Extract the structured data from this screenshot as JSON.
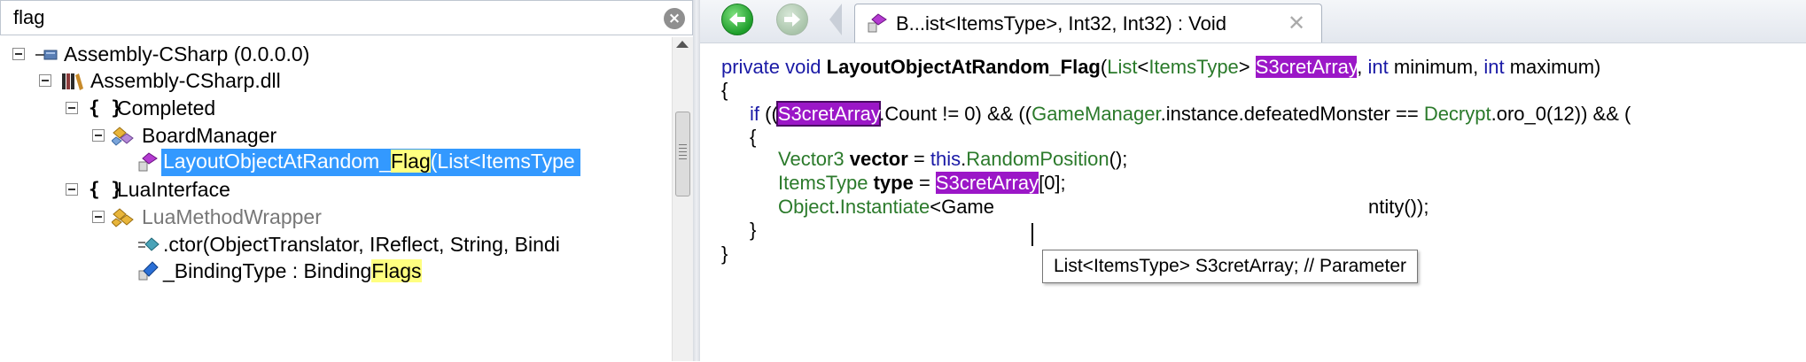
{
  "search": {
    "value": "flag",
    "clear_label": "⨯"
  },
  "tree": [
    {
      "label": "Assembly-CSharp (0.0.0.0)",
      "icon": "assembly-icon"
    },
    {
      "label": "Assembly-CSharp.dll",
      "icon": "library-icon"
    },
    {
      "label": "Completed",
      "icon": "namespace-braces-icon",
      "glyph": "{ }"
    },
    {
      "label": "BoardManager",
      "icon": "class-icon"
    },
    {
      "label_pre": "LayoutObjectAtRandom_",
      "label_hl": "Flag",
      "label_post": "(List<ItemsType",
      "icon": "method-icon",
      "selected": true
    },
    {
      "label": "LuaInterface",
      "icon": "namespace-braces-icon",
      "glyph": "{ }"
    },
    {
      "label": "LuaMethodWrapper",
      "icon": "class-icon"
    },
    {
      "label": ".ctor(ObjectTranslator, IReflect, String, Bindi",
      "icon": "constructor-icon"
    },
    {
      "label_pre": "_BindingType : Binding",
      "label_hl": "Flags",
      "label_post": "",
      "icon": "field-icon"
    }
  ],
  "tab": {
    "title": "B...ist<ItemsType>, Int32, Int32) : Void",
    "close": "✕"
  },
  "code": {
    "l1": {
      "kw1": "private void ",
      "method": "LayoutObjectAtRandom_Flag",
      "p1": "(",
      "t1": "List",
      "p2": "<",
      "t2": "ItemsType",
      "p3": "> ",
      "param": "S3cretArray",
      "p4": ", ",
      "kw2": "int",
      "p5": " minimum, ",
      "kw3": "int",
      "p6": " maximum)"
    },
    "l2": "{",
    "l3": {
      "kw": "if",
      "p1": " ((",
      "param": "S3cretArray",
      "p2": ".Count != 0) && ((",
      "t1": "GameManager",
      "p3": ".instance.defeatedMonster == ",
      "t2": "Decrypt",
      "p4": ".oro_0(12)) && ("
    },
    "l4": "{",
    "l5": {
      "t": "Vector3",
      "v": " vector",
      "p1": " = ",
      "kw": "this",
      "p2": ".",
      "m": "RandomPosition",
      "p3": "();"
    },
    "l6": {
      "t": "ItemsType",
      "v": " type",
      "p1": " = ",
      "param": "S3cretArray",
      "p2": "[0];"
    },
    "l7": {
      "t": "Object",
      "p1": ".",
      "m": "Instantiate",
      "p2": "<Game",
      "tail": "ntity());"
    },
    "l8": "}",
    "l9": "}"
  },
  "tooltip": "List<ItemsType> S3cretArray; // Parameter"
}
